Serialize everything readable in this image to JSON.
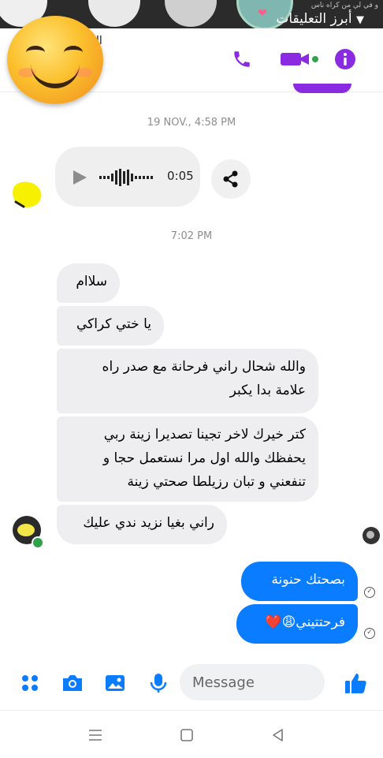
{
  "top_overlay": {
    "small_text": "و في لي من كراه ناس",
    "comments_label": "أبرز التعليقات",
    "comments_chevron_icon": "chevron-down-icon"
  },
  "header": {
    "title_fragment": "ll",
    "icons": [
      "phone-icon",
      "video-camera-icon",
      "info-icon"
    ],
    "accent_color": "#8a2be2"
  },
  "thread": {
    "timestamp_1": "19 NOV., 4:58 PM",
    "voice_message": {
      "duration": "0:05",
      "icons": [
        "play-icon",
        "waveform-icon",
        "share-icon"
      ]
    },
    "timestamp_2": "7:02 PM",
    "incoming": [
      "سلاام",
      "يا ختي كراكي",
      "والله شحال راني فرحانة مع صدر راه\nعلامة بدا يكبر",
      "كتر خيرك لاخر تجينا تصديرا زينة ربي\nيحفظك والله اول مرا نستعمل حجا و\nتنفعني و تبان رزيلطا صحتي زينة",
      "راني بغيا نزيد ندي عليك"
    ],
    "outgoing": [
      "بصحتك حنونة",
      "فرحتتيني😩❤️"
    ],
    "outgoing_color": "#0a7cff"
  },
  "composer": {
    "placeholder": "Message",
    "icons": [
      "apps-icon",
      "camera-icon",
      "gallery-icon",
      "microphone-icon",
      "emoji-icon",
      "thumbs-up-icon"
    ],
    "accent_color": "#0a7cff"
  },
  "system_nav": {
    "icons": [
      "menu-icon",
      "home-icon",
      "back-icon"
    ]
  }
}
